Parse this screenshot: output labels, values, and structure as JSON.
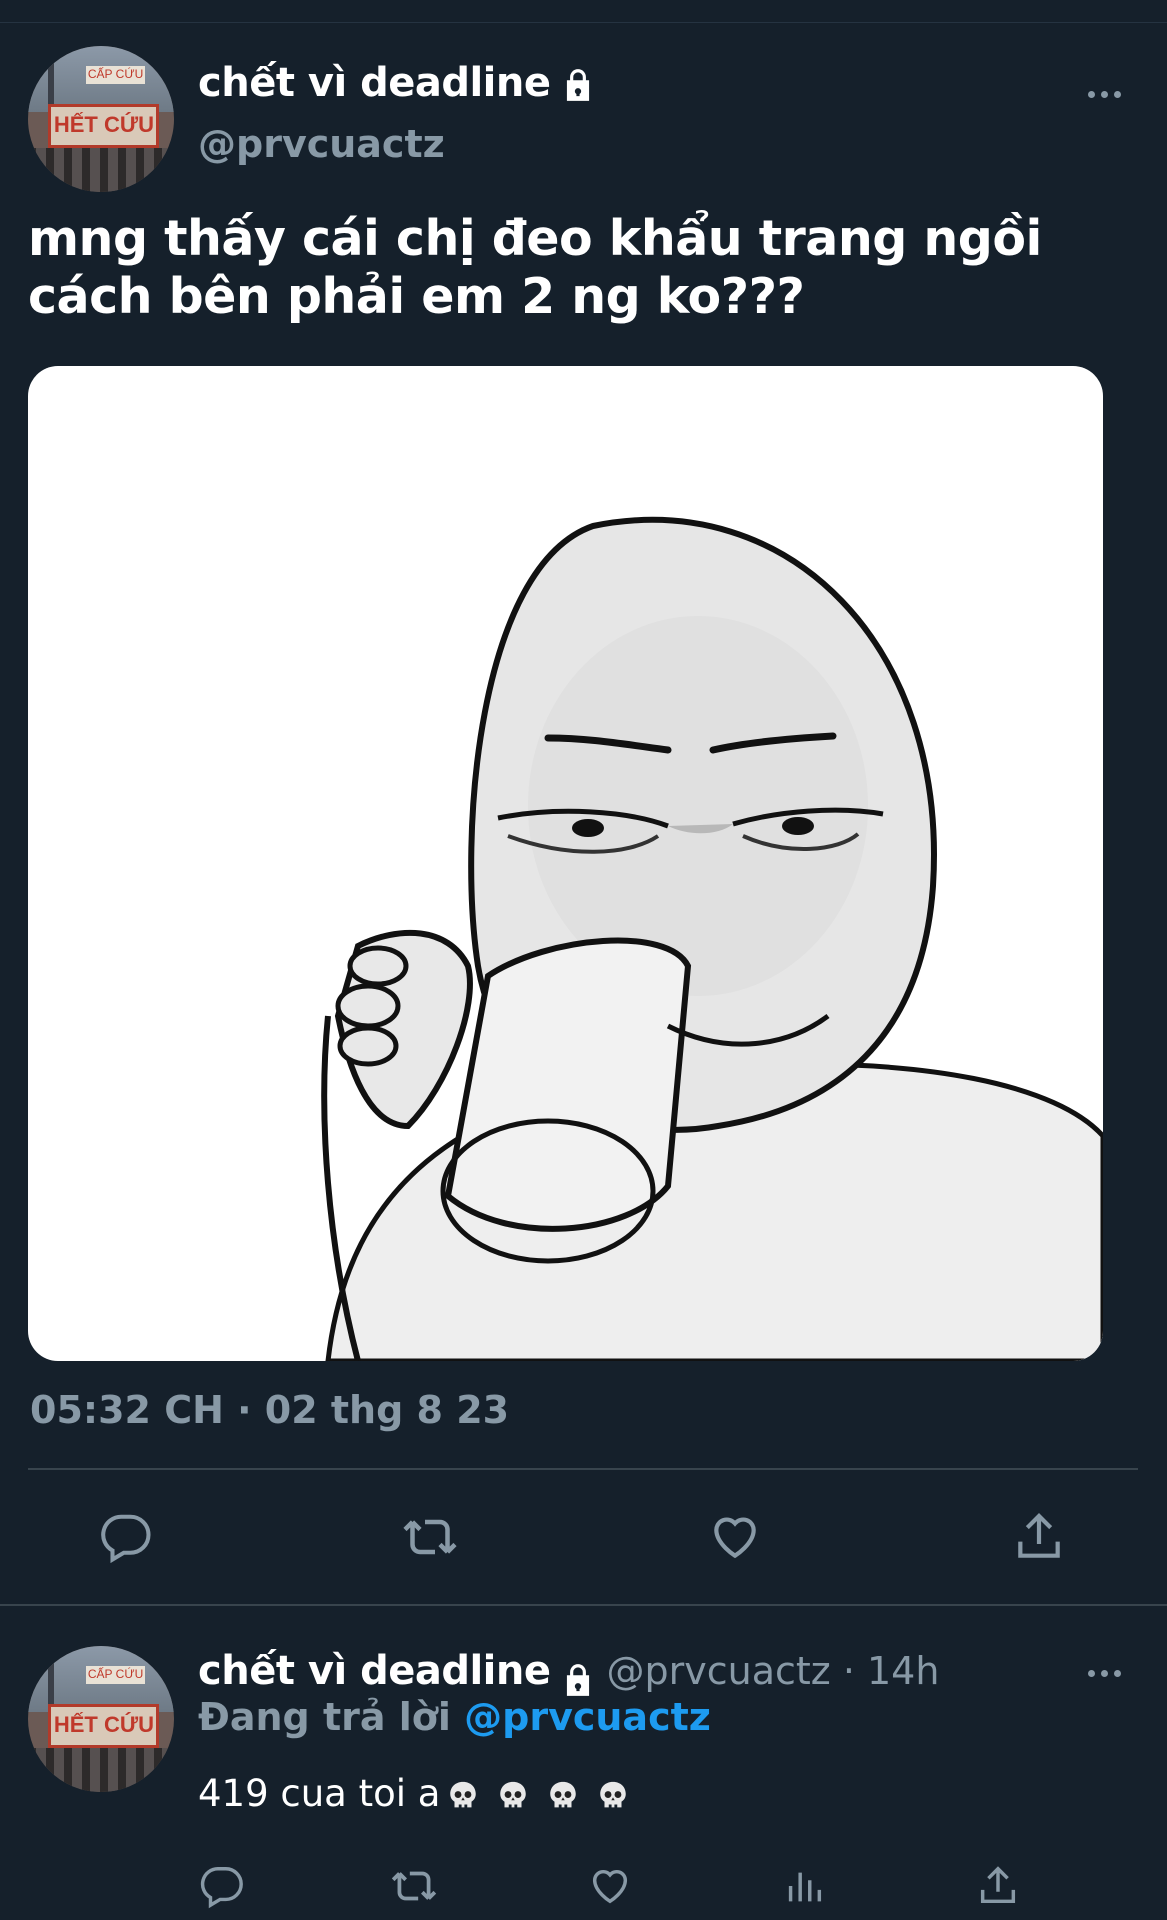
{
  "tweet": {
    "display_name": "chết vì deadline",
    "handle": "@prvcuactz",
    "text": "mng thấy cái chị đeo khẩu trang ngồi cách bên phải em 2 ng ko???",
    "timestamp": "05:32 CH · 02 thg 8 23",
    "avatar_sign_text": "HẾT CỨU",
    "avatar_sign_top": "CẤP CỨU"
  },
  "reply": {
    "display_name": "chết vì deadline",
    "handle": "@prvcuactz",
    "dot": " · ",
    "time": "14h",
    "replying_label": "Đang trả lời ",
    "replying_to": "@prvcuactz",
    "text": "419 cua toi a"
  },
  "icons": {
    "lock": "lock-icon",
    "more": "more-icon",
    "reply": "reply-icon",
    "retweet": "retweet-icon",
    "like": "heart-icon",
    "share": "share-icon",
    "analytics": "analytics-icon",
    "emoji": "skull-emoji"
  },
  "colors": {
    "background": "#15202b",
    "secondary_text": "#8899a6",
    "mention": "#1d9bf0",
    "divider": "#38444d"
  }
}
